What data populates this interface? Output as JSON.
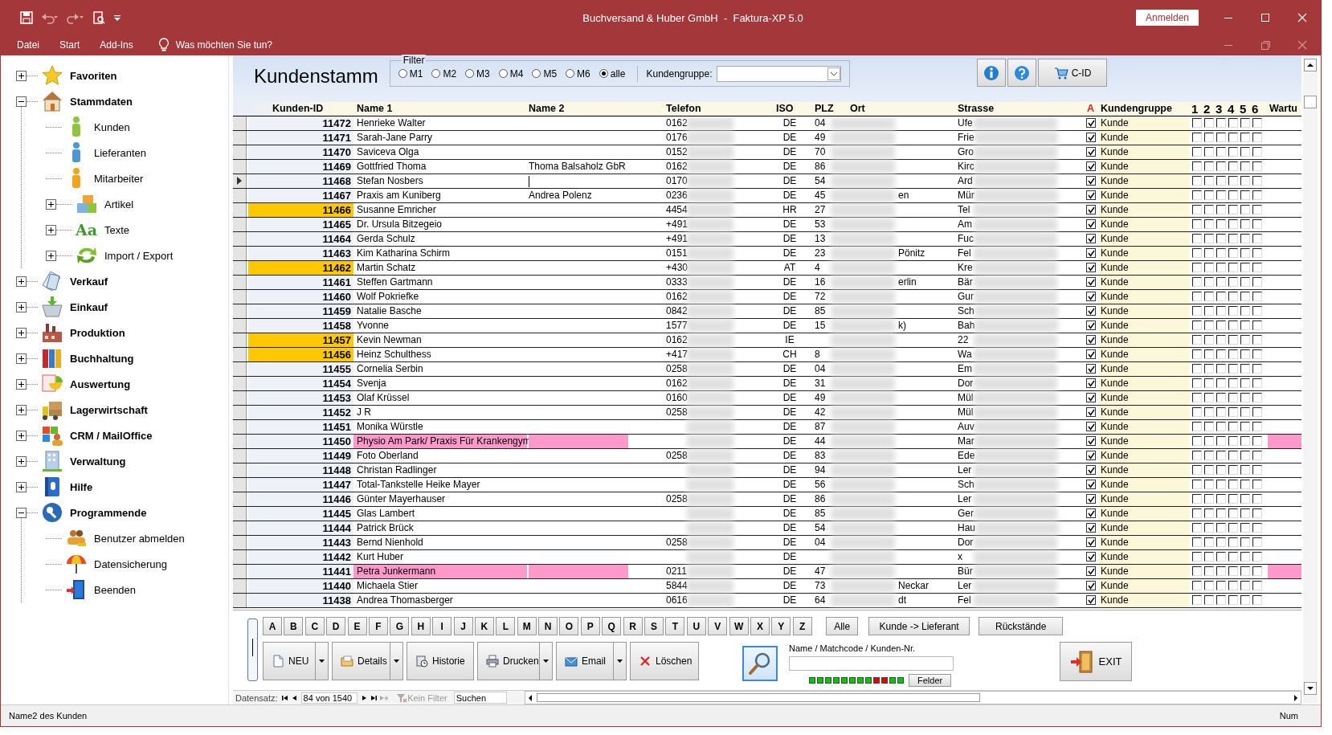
{
  "window": {
    "title": "Buchversand & Huber GmbH  -  Faktura-XP 5.0",
    "login_button": "Anmelden"
  },
  "menu": [
    {
      "label": "Datei"
    },
    {
      "label": "Start"
    },
    {
      "label": "Add-Ins"
    }
  ],
  "tell_me": "Was möchten Sie tun?",
  "sidebar": {
    "items": [
      {
        "label": "Favoriten",
        "kind": "folder",
        "expanded": false
      },
      {
        "label": "Stammdaten",
        "kind": "folder",
        "expanded": true,
        "children": [
          {
            "label": "Kunden",
            "kind": "leaf"
          },
          {
            "label": "Lieferanten",
            "kind": "leaf"
          },
          {
            "label": "Mitarbeiter",
            "kind": "leaf"
          },
          {
            "label": "Artikel",
            "kind": "folder",
            "expanded": false
          },
          {
            "label": "Texte",
            "kind": "folder",
            "expanded": false,
            "icon_text": "Aa"
          },
          {
            "label": "Import / Export",
            "kind": "folder",
            "expanded": false
          }
        ]
      },
      {
        "label": "Verkauf",
        "kind": "folder",
        "expanded": false
      },
      {
        "label": "Einkauf",
        "kind": "folder",
        "expanded": false
      },
      {
        "label": "Produktion",
        "kind": "folder",
        "expanded": false
      },
      {
        "label": "Buchhaltung",
        "kind": "folder",
        "expanded": false
      },
      {
        "label": "Auswertung",
        "kind": "folder",
        "expanded": false
      },
      {
        "label": "Lagerwirtschaft",
        "kind": "folder",
        "expanded": false
      },
      {
        "label": "CRM / MailOffice",
        "kind": "folder",
        "expanded": false
      },
      {
        "label": "Verwaltung",
        "kind": "folder",
        "expanded": false
      },
      {
        "label": "Hilfe",
        "kind": "folder",
        "expanded": false
      },
      {
        "label": "Programmende",
        "kind": "folder",
        "expanded": true,
        "children": [
          {
            "label": "Benutzer abmelden",
            "kind": "leaf"
          },
          {
            "label": "Datensicherung",
            "kind": "leaf"
          },
          {
            "label": "Beenden",
            "kind": "leaf"
          }
        ]
      }
    ]
  },
  "form": {
    "title": "Kundenstamm",
    "filter": {
      "legend": "Filter",
      "options": [
        {
          "label": "M1",
          "selected": false
        },
        {
          "label": "M2",
          "selected": false
        },
        {
          "label": "M3",
          "selected": false
        },
        {
          "label": "M4",
          "selected": false
        },
        {
          "label": "M5",
          "selected": false
        },
        {
          "label": "M6",
          "selected": false
        },
        {
          "label": "alle",
          "selected": true
        }
      ],
      "group_label": "Kundengruppe:"
    },
    "toolbar_buttons": [
      {
        "kind": "info"
      },
      {
        "kind": "help"
      },
      {
        "kind": "cart",
        "label": "C-ID"
      }
    ]
  },
  "table": {
    "columns": [
      "Kunden-ID",
      "Name 1",
      "Name 2",
      "Telefon",
      "ISO",
      "PLZ",
      "Ort",
      "Strasse",
      "A",
      "Kundengruppe",
      "1",
      "2",
      "3",
      "4",
      "5",
      "6",
      "Wartu"
    ],
    "rows": [
      {
        "id": "11472",
        "name1": "Henrieke Walter",
        "phone": "0162",
        "iso": "DE",
        "plz": "04",
        "street": "Ufe",
        "active": true,
        "group": "Kunde",
        "marks": [
          false,
          false,
          false,
          false,
          false,
          false
        ],
        "highlight": false,
        "flagged": false,
        "selected": false
      },
      {
        "id": "11471",
        "name1": "Sarah-Jane Parry",
        "phone": "0176",
        "iso": "DE",
        "plz": "49",
        "street": "Frie",
        "active": true,
        "group": "Kunde",
        "marks": [
          false,
          false,
          false,
          false,
          false,
          false
        ],
        "highlight": false,
        "flagged": false,
        "selected": false
      },
      {
        "id": "11470",
        "name1": "Saviceva Olga",
        "phone": "0152",
        "iso": "DE",
        "plz": "70",
        "street": "Gro",
        "active": true,
        "group": "Kunde",
        "marks": [
          false,
          false,
          false,
          false,
          false,
          false
        ],
        "highlight": false,
        "flagged": false,
        "selected": false
      },
      {
        "id": "11469",
        "name1": "Gottfried Thoma",
        "name2": "Thoma Balsaholz GbR",
        "phone": "0162",
        "iso": "DE",
        "plz": "86",
        "street": "Kirc",
        "active": true,
        "group": "Kunde",
        "marks": [
          false,
          false,
          false,
          false,
          false,
          false
        ],
        "highlight": false,
        "flagged": false,
        "selected": false
      },
      {
        "id": "11468",
        "name1": "Stefan Nosbers",
        "phone": "0170",
        "iso": "DE",
        "plz": "54",
        "street": "Ard",
        "active": true,
        "group": "Kunde",
        "marks": [
          false,
          false,
          false,
          false,
          false,
          false
        ],
        "highlight": false,
        "flagged": false,
        "selected": true
      },
      {
        "id": "11467",
        "name1": "Praxis am Kuniberg",
        "name2": "Andrea Polenz",
        "phone": "0236",
        "iso": "DE",
        "plz": "45",
        "ort": "en",
        "street": "Mür",
        "active": true,
        "group": "Kunde",
        "marks": [
          false,
          false,
          false,
          false,
          false,
          false
        ],
        "highlight": false,
        "flagged": false,
        "selected": false
      },
      {
        "id": "11466",
        "name1": "Susanne Emricher",
        "phone": "4454",
        "iso": "HR",
        "plz": "27",
        "street": "Tel",
        "active": true,
        "group": "Kunde",
        "marks": [
          false,
          false,
          false,
          false,
          false,
          false
        ],
        "highlight": true,
        "flagged": false,
        "selected": false
      },
      {
        "id": "11465",
        "name1": "Dr. Ursula Bitzegeio",
        "phone": "+491",
        "iso": "DE",
        "plz": "53",
        "street": "Am",
        "active": true,
        "group": "Kunde",
        "marks": [
          false,
          false,
          false,
          false,
          false,
          false
        ],
        "highlight": false,
        "flagged": false,
        "selected": false
      },
      {
        "id": "11464",
        "name1": "Gerda Schulz",
        "phone": "+491",
        "iso": "DE",
        "plz": "13",
        "street": "Fuc",
        "active": true,
        "group": "Kunde",
        "marks": [
          false,
          false,
          false,
          false,
          false,
          false
        ],
        "highlight": false,
        "flagged": false,
        "selected": false
      },
      {
        "id": "11463",
        "name1": "Kim Katharina Schirm",
        "phone": "0151",
        "iso": "DE",
        "plz": "23",
        "ort": "Pönitz",
        "street": "Fel",
        "active": true,
        "group": "Kunde",
        "marks": [
          false,
          false,
          false,
          false,
          false,
          false
        ],
        "highlight": false,
        "flagged": false,
        "selected": false
      },
      {
        "id": "11462",
        "name1": "Martin Schatz",
        "phone": "+430",
        "iso": "AT",
        "plz": "4",
        "street": "Kre",
        "active": true,
        "group": "Kunde",
        "marks": [
          false,
          false,
          false,
          false,
          false,
          false
        ],
        "highlight": true,
        "flagged": false,
        "selected": false
      },
      {
        "id": "11461",
        "name1": "Steffen Gartmann",
        "phone": "0333",
        "iso": "DE",
        "plz": "16",
        "ort": "erlin",
        "street": "Bär",
        "active": true,
        "group": "Kunde",
        "marks": [
          false,
          false,
          false,
          false,
          false,
          false
        ],
        "highlight": false,
        "flagged": false,
        "selected": false
      },
      {
        "id": "11460",
        "name1": "Wolf Pokriefke",
        "phone": "0162",
        "iso": "DE",
        "plz": "72",
        "street": "Gur",
        "active": true,
        "group": "Kunde",
        "marks": [
          false,
          false,
          false,
          false,
          false,
          false
        ],
        "highlight": false,
        "flagged": false,
        "selected": false
      },
      {
        "id": "11459",
        "name1": "Natalie Basche",
        "phone": "0842",
        "iso": "DE",
        "plz": "85",
        "street": "Sch",
        "active": true,
        "group": "Kunde",
        "marks": [
          false,
          false,
          false,
          false,
          false,
          false
        ],
        "highlight": false,
        "flagged": false,
        "selected": false
      },
      {
        "id": "11458",
        "name1": "Yvonne",
        "phone": "1577",
        "iso": "DE",
        "plz": "15",
        "ort": "k)",
        "street": "Bah",
        "active": true,
        "group": "Kunde",
        "marks": [
          false,
          false,
          false,
          false,
          false,
          false
        ],
        "highlight": false,
        "flagged": false,
        "selected": false
      },
      {
        "id": "11457",
        "name1": "Kevin Newman",
        "phone": "0162",
        "iso": "IE",
        "street": "22",
        "active": true,
        "group": "Kunde",
        "marks": [
          false,
          false,
          false,
          false,
          false,
          false
        ],
        "highlight": true,
        "flagged": false,
        "selected": false
      },
      {
        "id": "11456",
        "name1": "Heinz Schulthess",
        "phone": "+417",
        "iso": "CH",
        "plz": "8",
        "street": "Wa",
        "active": true,
        "group": "Kunde",
        "marks": [
          false,
          false,
          false,
          false,
          false,
          false
        ],
        "highlight": true,
        "flagged": false,
        "selected": false
      },
      {
        "id": "11455",
        "name1": "Cornelia Serbin",
        "phone": "0258",
        "iso": "DE",
        "plz": "04",
        "street": "Em",
        "active": true,
        "group": "Kunde",
        "marks": [
          false,
          false,
          false,
          false,
          false,
          false
        ],
        "highlight": false,
        "flagged": false,
        "selected": false
      },
      {
        "id": "11454",
        "name1": "Svenja",
        "phone": "0162",
        "iso": "DE",
        "plz": "31",
        "street": "Dor",
        "active": true,
        "group": "Kunde",
        "marks": [
          false,
          false,
          false,
          false,
          false,
          false
        ],
        "highlight": false,
        "flagged": false,
        "selected": false
      },
      {
        "id": "11453",
        "name1": "Olaf Krüssel",
        "phone": "0160",
        "iso": "DE",
        "plz": "49",
        "street": "Mül",
        "active": true,
        "group": "Kunde",
        "marks": [
          false,
          false,
          false,
          false,
          false,
          false
        ],
        "highlight": false,
        "flagged": false,
        "selected": false
      },
      {
        "id": "11452",
        "name1": "J R",
        "phone": "0258",
        "iso": "DE",
        "plz": "42",
        "street": "Mül",
        "active": true,
        "group": "Kunde",
        "marks": [
          false,
          false,
          false,
          false,
          false,
          false
        ],
        "highlight": false,
        "flagged": false,
        "selected": false
      },
      {
        "id": "11451",
        "name1": "Monika Würstle",
        "iso": "DE",
        "plz": "87",
        "street": "Auv",
        "active": true,
        "group": "Kunde",
        "marks": [
          false,
          false,
          false,
          false,
          false,
          false
        ],
        "highlight": false,
        "flagged": false,
        "selected": false
      },
      {
        "id": "11450",
        "name1": "Physio Am Park/ Praxis Für Krankengym",
        "iso": "DE",
        "plz": "44",
        "street": "Mar",
        "active": true,
        "group": "Kunde",
        "marks": [
          false,
          false,
          false,
          false,
          false,
          false
        ],
        "highlight": false,
        "flagged": true,
        "selected": false
      },
      {
        "id": "11449",
        "name1": "Foto Oberland",
        "phone": "0258",
        "iso": "DE",
        "plz": "83",
        "street": "Ede",
        "active": true,
        "group": "Kunde",
        "marks": [
          false,
          false,
          false,
          false,
          false,
          false
        ],
        "highlight": false,
        "flagged": false,
        "selected": false
      },
      {
        "id": "11448",
        "name1": "Christan Radlinger",
        "iso": "DE",
        "plz": "94",
        "street": "Ler",
        "active": true,
        "group": "Kunde",
        "marks": [
          false,
          false,
          false,
          false,
          false,
          false
        ],
        "highlight": false,
        "flagged": false,
        "selected": false
      },
      {
        "id": "11447",
        "name1": "Total-Tankstelle Heike Mayer",
        "iso": "DE",
        "plz": "56",
        "street": "Sch",
        "active": true,
        "group": "Kunde",
        "marks": [
          false,
          false,
          false,
          false,
          false,
          false
        ],
        "highlight": false,
        "flagged": false,
        "selected": false
      },
      {
        "id": "11446",
        "name1": "Günter Mayerhauser",
        "phone": "0258",
        "iso": "DE",
        "plz": "86",
        "street": "Ler",
        "active": true,
        "group": "Kunde",
        "marks": [
          false,
          false,
          false,
          false,
          false,
          false
        ],
        "highlight": false,
        "flagged": false,
        "selected": false
      },
      {
        "id": "11445",
        "name1": "Glas Lambert",
        "iso": "DE",
        "plz": "85",
        "street": "Ger",
        "active": true,
        "group": "Kunde",
        "marks": [
          false,
          false,
          false,
          false,
          false,
          false
        ],
        "highlight": false,
        "flagged": false,
        "selected": false
      },
      {
        "id": "11444",
        "name1": "Patrick Brück",
        "iso": "DE",
        "plz": "54",
        "street": "Hau",
        "active": true,
        "group": "Kunde",
        "marks": [
          false,
          false,
          false,
          false,
          false,
          false
        ],
        "highlight": false,
        "flagged": false,
        "selected": false
      },
      {
        "id": "11443",
        "name1": "Bernd Nienhold",
        "phone": "0258",
        "iso": "DE",
        "plz": "04",
        "street": "Dor",
        "active": true,
        "group": "Kunde",
        "marks": [
          false,
          false,
          false,
          false,
          false,
          false
        ],
        "highlight": false,
        "flagged": false,
        "selected": false
      },
      {
        "id": "11442",
        "name1": "Kurt Huber",
        "iso": "DE",
        "street": "x",
        "active": true,
        "group": "Kunde",
        "marks": [
          false,
          false,
          false,
          false,
          false,
          false
        ],
        "highlight": false,
        "flagged": false,
        "selected": false
      },
      {
        "id": "11441",
        "name1": "Petra Junkermann",
        "phone": "0211",
        "iso": "DE",
        "plz": "47",
        "street": "Bür",
        "active": true,
        "group": "Kunde",
        "marks": [
          false,
          false,
          false,
          false,
          false,
          false
        ],
        "highlight": false,
        "flagged": true,
        "selected": false
      },
      {
        "id": "11440",
        "name1": "Michaela Stier",
        "phone": "5844",
        "iso": "DE",
        "plz": "73",
        "ort": "Neckar",
        "street": "Ler",
        "active": true,
        "group": "Kunde",
        "marks": [
          false,
          false,
          false,
          false,
          false,
          false
        ],
        "highlight": false,
        "flagged": false,
        "selected": false
      },
      {
        "id": "11438",
        "name1": "Andrea Thomasberger",
        "phone": "0616",
        "iso": "DE",
        "plz": "64",
        "ort": "dt",
        "street": "Fel",
        "active": true,
        "group": "Kunde",
        "marks": [
          false,
          false,
          false,
          false,
          false,
          false
        ],
        "highlight": false,
        "flagged": false,
        "selected": false
      }
    ]
  },
  "letters": [
    "A",
    "B",
    "C",
    "D",
    "E",
    "F",
    "G",
    "H",
    "I",
    "J",
    "K",
    "L",
    "M",
    "N",
    "O",
    "P",
    "Q",
    "R",
    "S",
    "T",
    "U",
    "V",
    "W",
    "X",
    "Y",
    "Z"
  ],
  "filter_buttons": [
    "Alle",
    "Kunde -> Lieferant",
    "Rückstände"
  ],
  "actions": [
    {
      "label": "NEU",
      "kind": "new",
      "dropdown": true
    },
    {
      "label": "Details",
      "kind": "details",
      "dropdown": true
    },
    {
      "label": "Historie",
      "kind": "history",
      "dropdown": false
    },
    {
      "label": "Drucken",
      "kind": "print",
      "dropdown": true
    },
    {
      "label": "Email",
      "kind": "email",
      "dropdown": true
    },
    {
      "label": "Löschen",
      "kind": "delete",
      "dropdown": false
    }
  ],
  "search": {
    "label": "Name / Matchcode / Kunden-Nr.",
    "fields_button": "Felder",
    "leds": [
      {
        "color": "#00c800"
      },
      {
        "color": "#00c800"
      },
      {
        "color": "#00c800"
      },
      {
        "color": "#00c800"
      },
      {
        "color": "#00c800"
      },
      {
        "color": "#00c800"
      },
      {
        "color": "#00c800"
      },
      {
        "color": "#00c800"
      },
      {
        "color": "#e00000"
      },
      {
        "color": "#e00000"
      },
      {
        "color": "#00c800"
      },
      {
        "color": "#00c800"
      }
    ]
  },
  "exit_button": "EXIT",
  "navigation": {
    "label": "Datensatz:",
    "position": "84 von 1540",
    "filter": "Kein Filter",
    "filter_disabled": true,
    "search_placeholder": "Suchen"
  },
  "status_bar": {
    "text": "Name2 des Kunden",
    "mode": "Num"
  }
}
